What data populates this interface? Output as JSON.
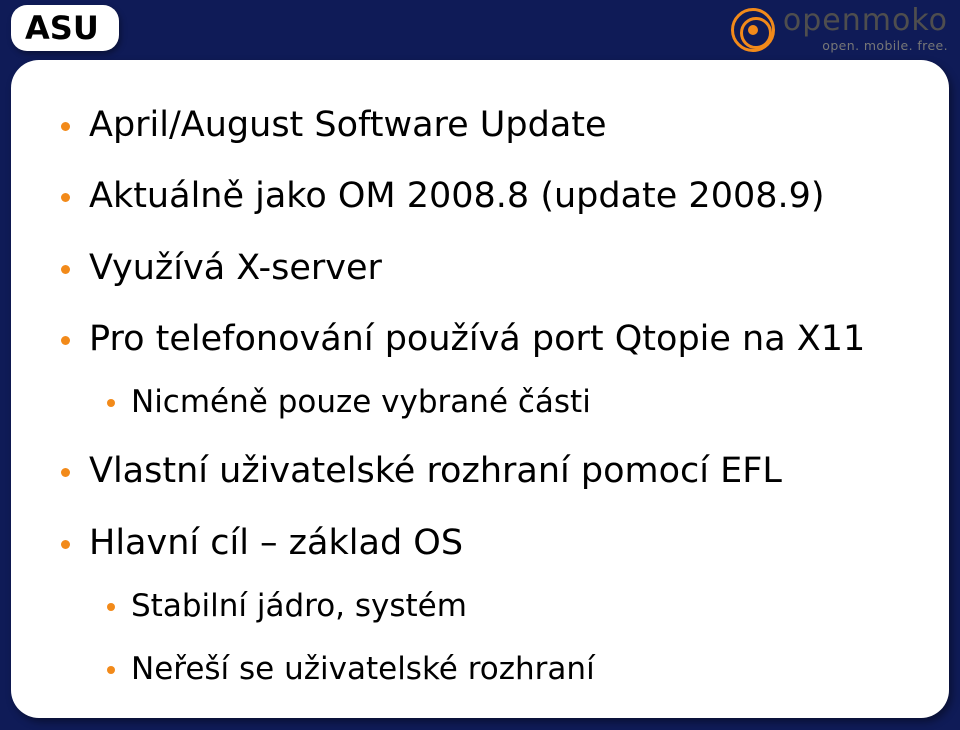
{
  "header": {
    "title": "ASU",
    "logo": {
      "brand": "openmoko",
      "tagline": "open. mobile. free."
    }
  },
  "bullets": [
    {
      "text": "April/August Software Update",
      "children": []
    },
    {
      "text": "Aktuálně jako OM 2008.8 (update 2008.9)",
      "children": []
    },
    {
      "text": "Využívá X-server",
      "children": []
    },
    {
      "text": "Pro telefonování používá port Qtopie na X11",
      "children": [
        {
          "text": "Nicméně pouze vybrané části",
          "children": []
        }
      ]
    },
    {
      "text": "Vlastní uživatelské rozhraní pomocí EFL",
      "children": []
    },
    {
      "text": "Hlavní cíl – základ OS",
      "children": [
        {
          "text": "Stabilní jádro, systém",
          "children": []
        },
        {
          "text": "Neřeší se uživatelské rozhraní",
          "children": []
        }
      ]
    }
  ]
}
